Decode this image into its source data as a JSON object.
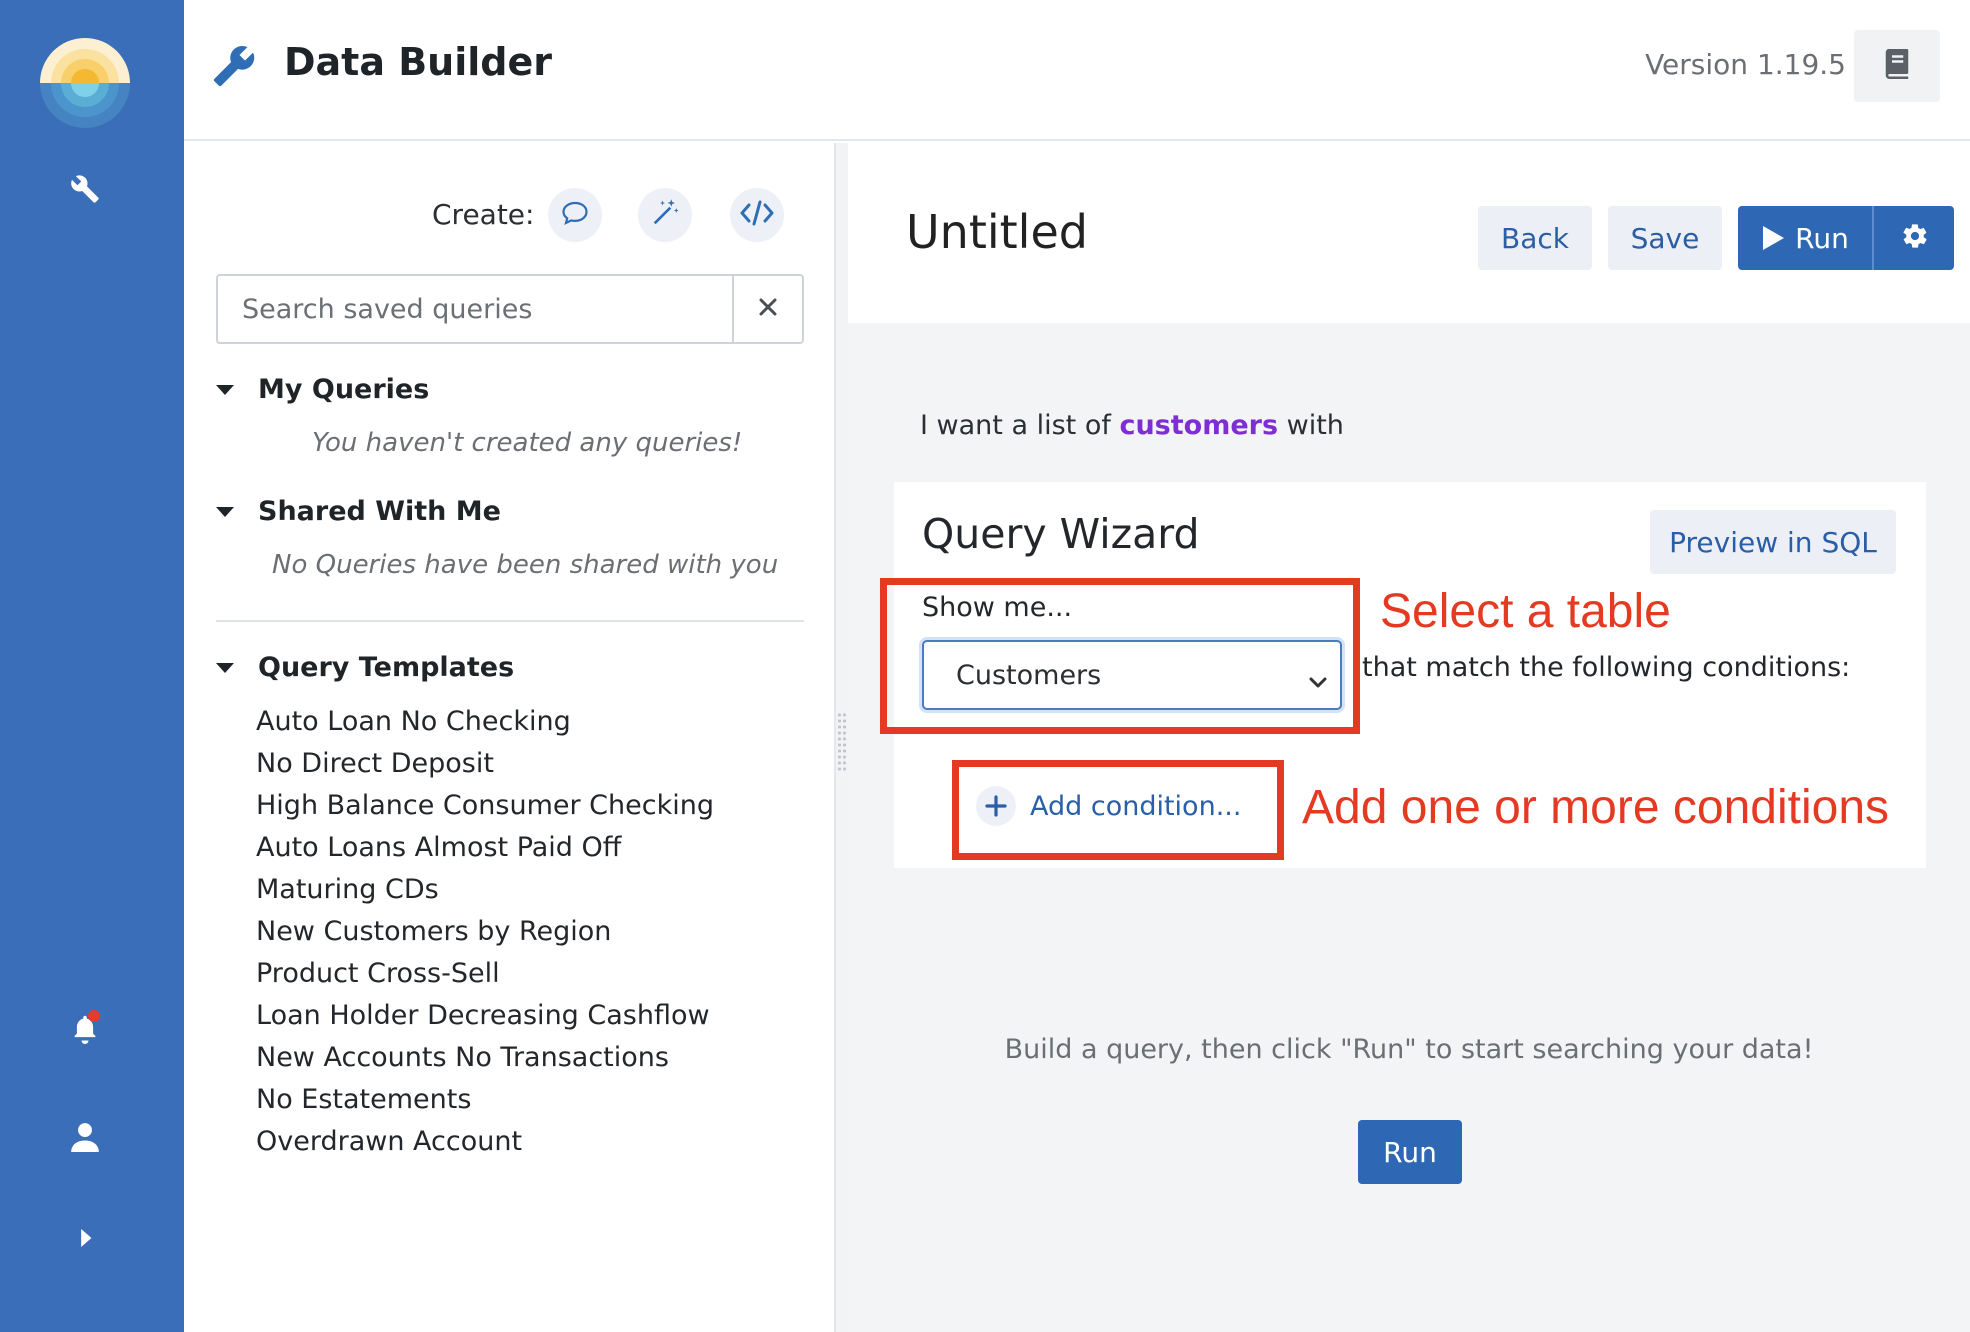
{
  "app": {
    "title": "Data Builder",
    "version": "Version 1.19.5",
    "accent_color": "#3b6eb8",
    "icons": {
      "logo": "sunrise-logo",
      "nav_tools": "wrench-icon",
      "notifications": "bell-icon",
      "profile": "user-icon",
      "expand": "chevron-right-icon",
      "docs": "book-icon"
    }
  },
  "sidebar": {
    "create_label": "Create:",
    "create_buttons": [
      {
        "icon": "chat-bubble-icon"
      },
      {
        "icon": "magic-wand-icon"
      },
      {
        "icon": "code-icon"
      }
    ],
    "search": {
      "placeholder": "Search saved queries",
      "value": ""
    },
    "sections": {
      "my_queries": {
        "title": "My Queries",
        "empty": "You haven't created any queries!"
      },
      "shared": {
        "title": "Shared With Me",
        "empty": "No Queries have been shared with you"
      },
      "templates": {
        "title": "Query Templates",
        "items": [
          "Auto Loan No Checking",
          "No Direct Deposit",
          "High Balance Consumer Checking",
          "Auto Loans Almost Paid Off",
          "Maturing CDs",
          "New Customers by Region",
          "Product Cross-Sell",
          "Loan Holder Decreasing Cashflow",
          "New Accounts No Transactions",
          "No Estatements",
          "Overdrawn Account"
        ]
      }
    }
  },
  "main": {
    "query_title": "Untitled",
    "buttons": {
      "back": "Back",
      "save": "Save",
      "run": "Run"
    },
    "intro": {
      "before": "I want a list of ",
      "entity": "customers",
      "after": " with"
    },
    "wizard": {
      "title": "Query Wizard",
      "preview": "Preview in SQL",
      "show_me": "Show me...",
      "table_value": "Customers",
      "match_text": "that match the following conditions:",
      "add_condition": "Add condition..."
    },
    "hint": "Build a query, then click \"Run\" to start searching your data!",
    "run_bottom": "Run"
  },
  "annotations": {
    "select_table": "Select a table",
    "add_conditions": "Add one or more conditions",
    "color": "#e53a22"
  }
}
